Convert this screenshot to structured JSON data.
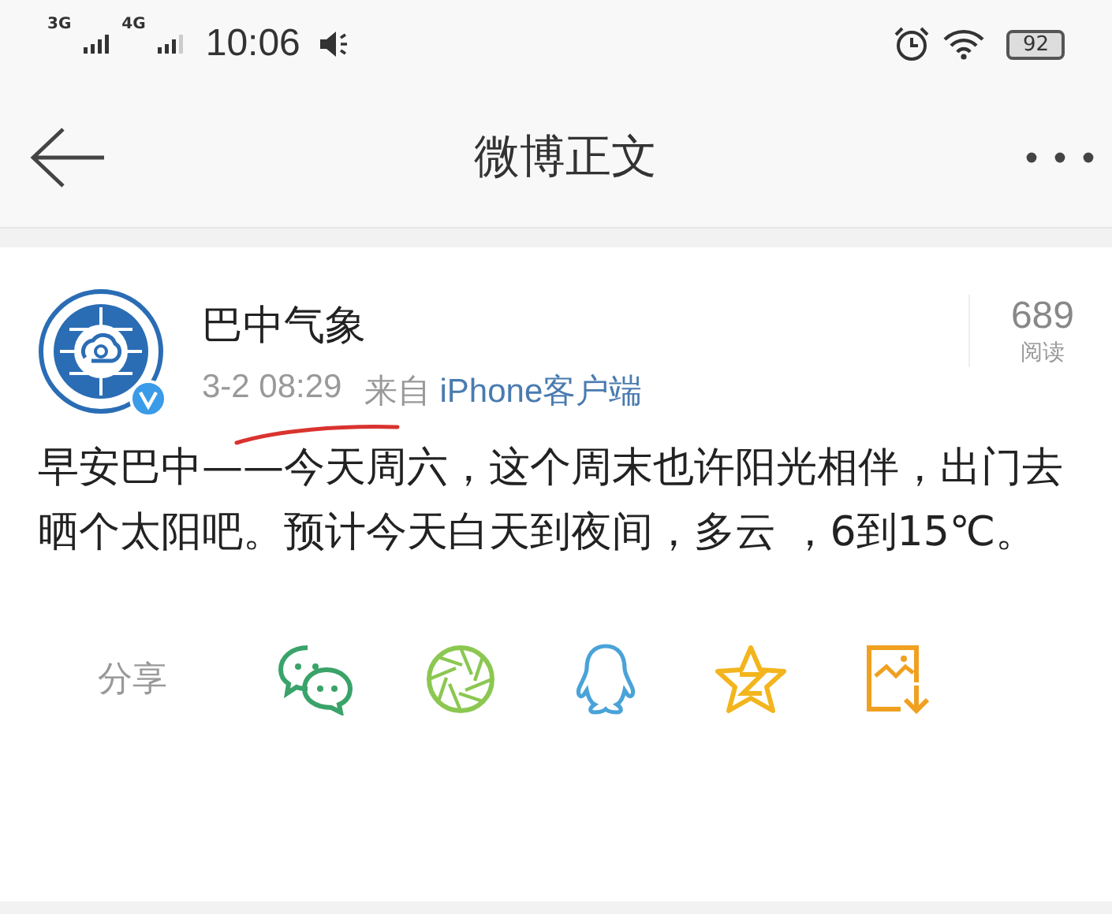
{
  "status_bar": {
    "network_1": "3G",
    "network_2": "4G",
    "time": "10:06",
    "battery": "92"
  },
  "header": {
    "title": "微博正文"
  },
  "post": {
    "author": "巴中气象",
    "verified": true,
    "date": "3-2 08:29",
    "source_prefix": "来自",
    "source": "iPhone客户端",
    "read_count": "689",
    "read_label": "阅读",
    "text": "早安巴中——今天周六，这个周末也许阳光相伴，出门去晒个太阳吧。预计今天白天到夜间，多云 ，6到15℃。"
  },
  "share": {
    "label": "分享",
    "targets": [
      {
        "kind": "wechat"
      },
      {
        "kind": "moments"
      },
      {
        "kind": "qq"
      },
      {
        "kind": "qzone"
      },
      {
        "kind": "save"
      }
    ]
  }
}
